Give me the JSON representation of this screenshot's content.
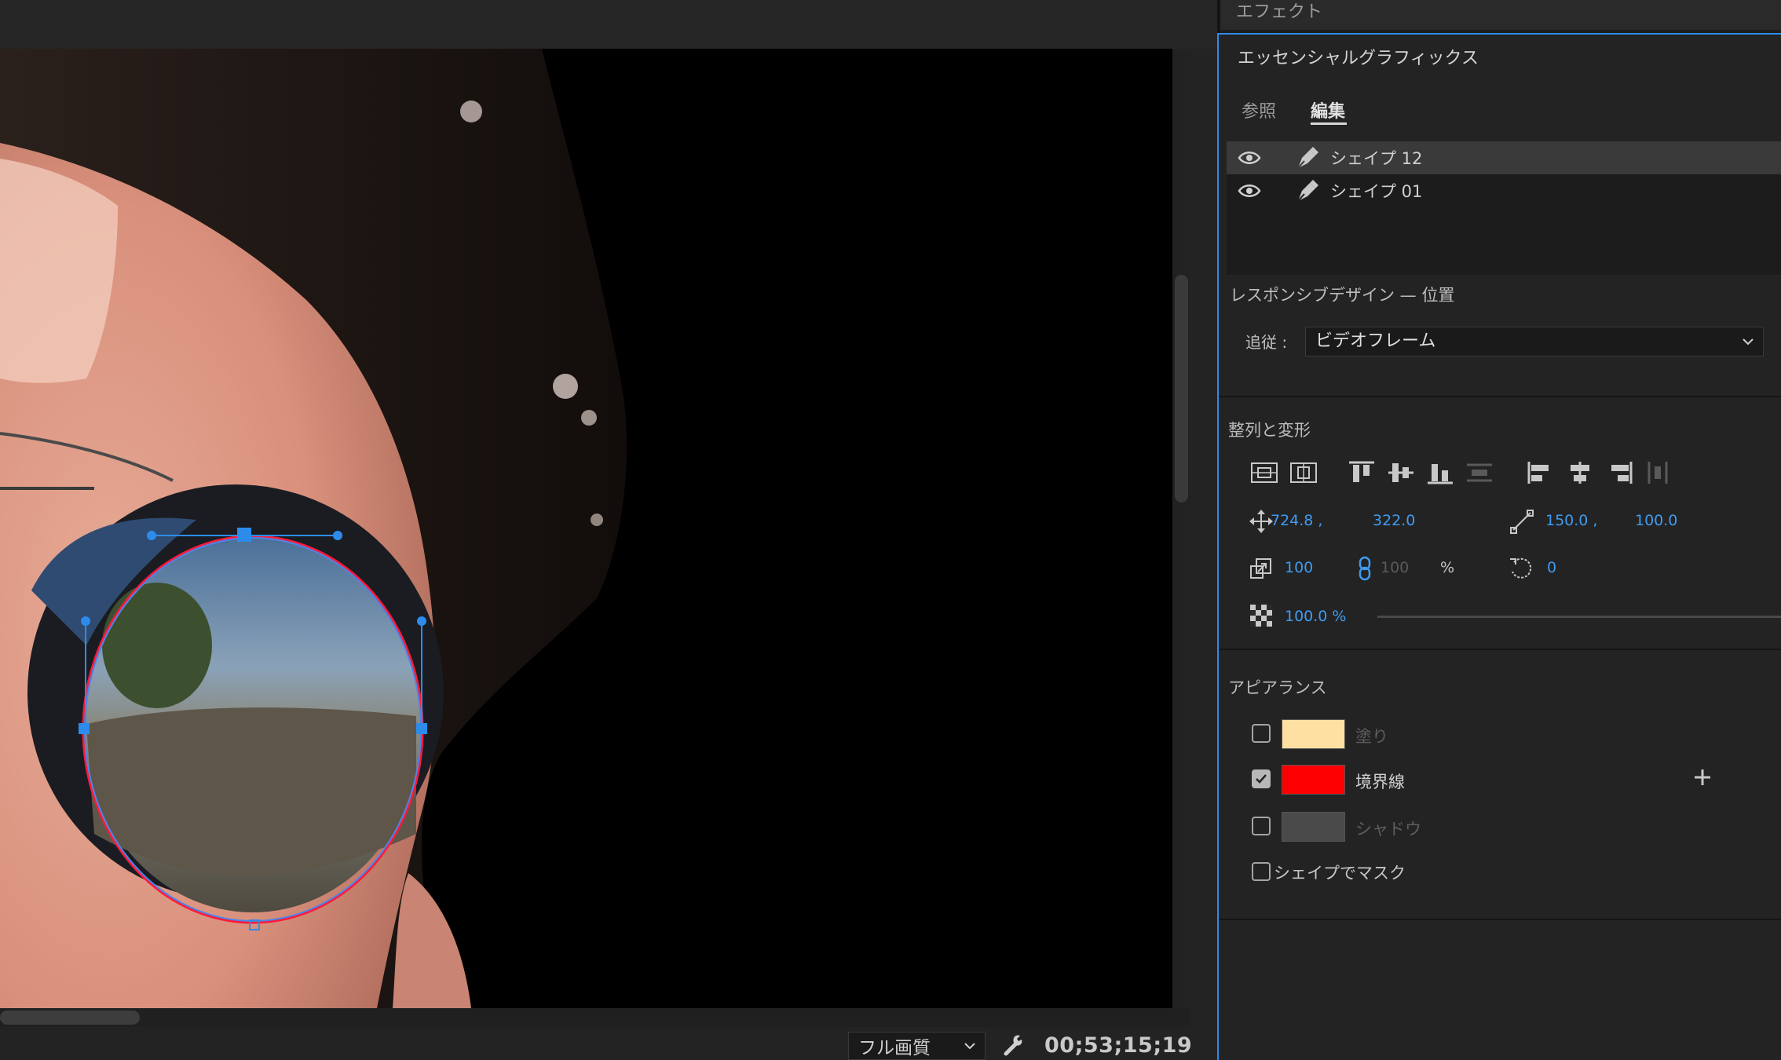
{
  "monitor": {
    "quality_label": "フル画質",
    "timecode": "00;53;15;19"
  },
  "effects_panel": {
    "label": "エフェクト"
  },
  "essential_graphics": {
    "title": "エッセンシャルグラフィックス",
    "tabs": [
      {
        "label": "参照",
        "active": false
      },
      {
        "label": "編集",
        "active": true
      }
    ],
    "layers": [
      {
        "name": "シェイプ 12",
        "selected": true
      },
      {
        "name": "シェイプ 01",
        "selected": false
      }
    ],
    "responsive": {
      "title": "レスポンシブデザイン — 位置",
      "follow_label": "追従 :",
      "follow_value": "ビデオフレーム"
    },
    "align_transform": {
      "title": "整列と変形",
      "position_x": "724.8 ,",
      "position_y": "322.0",
      "anchor_x": "150.0 ,",
      "anchor_y": "100.0",
      "scale": "100",
      "scale_height": "100",
      "scale_unit": "%",
      "rotation": "0",
      "opacity": "100.0 %"
    },
    "appearance": {
      "title": "アピアランス",
      "fill": {
        "label": "塗り",
        "checked": false,
        "color": "#ffe0a3"
      },
      "stroke": {
        "label": "境界線",
        "checked": true,
        "color": "#ff0000"
      },
      "shadow": {
        "label": "シャドウ",
        "checked": false,
        "color": "#4a4a4a"
      },
      "mask_label": "シェイプでマスク"
    }
  }
}
